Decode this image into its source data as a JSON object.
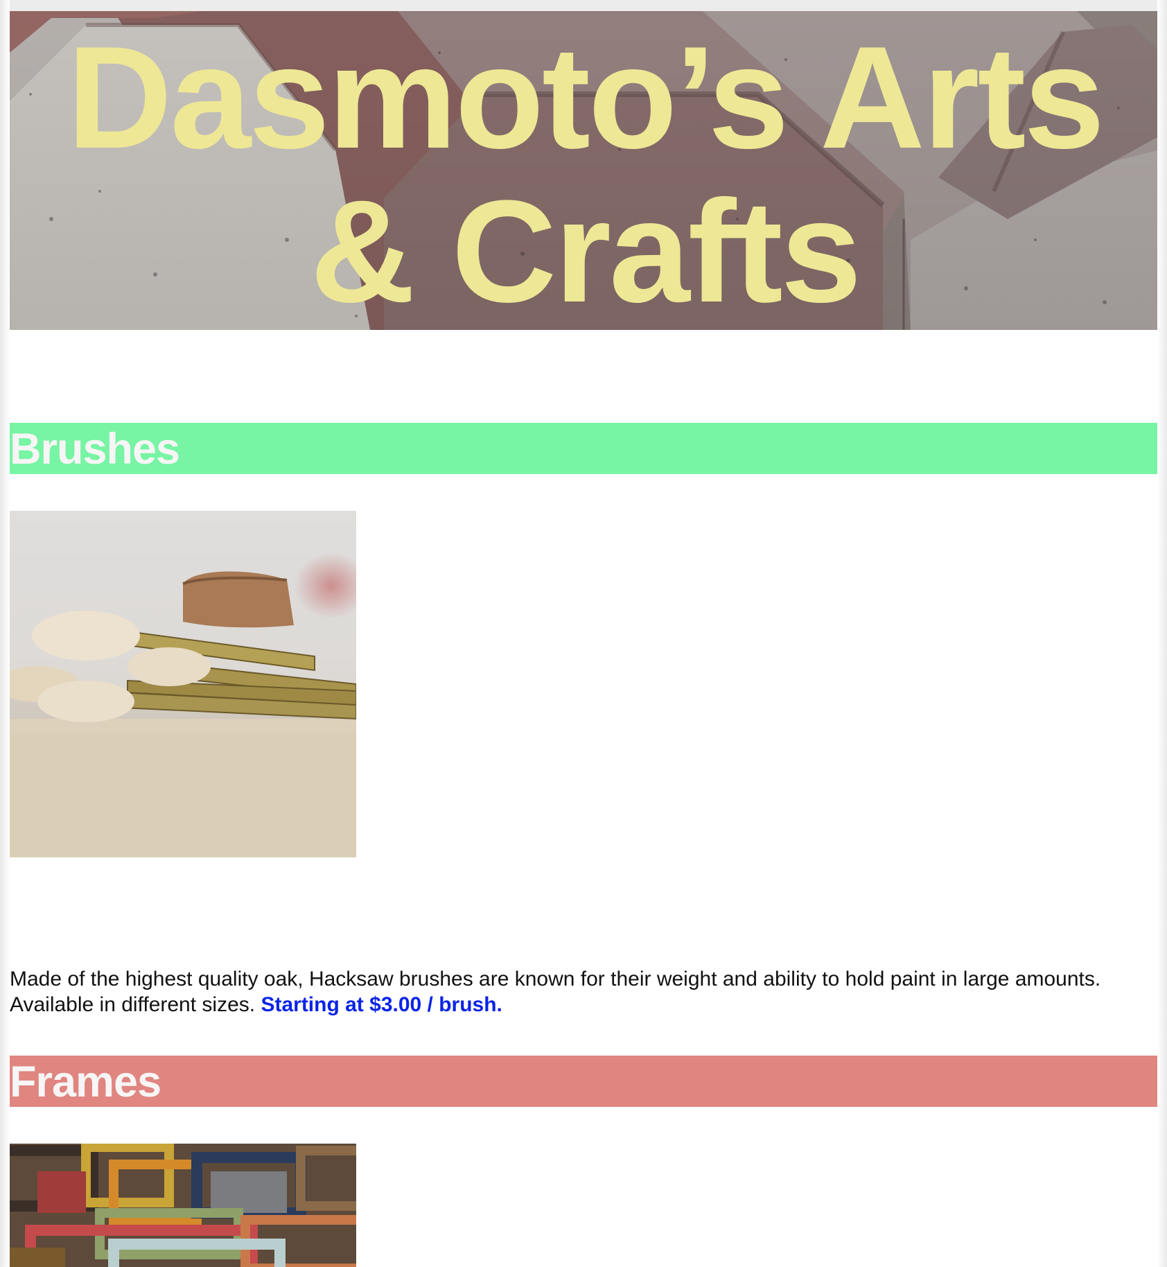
{
  "header": {
    "title": "Dasmoto’s Arts & Crafts"
  },
  "sections": [
    {
      "heading": "Brushes",
      "heading_color": "#77f4a4",
      "image": "paint-brushes-photo",
      "description": "Made of the highest quality oak, Hacksaw brushes are known for their weight and ability to hold paint in large amounts. Available in different sizes.",
      "price": "Starting at $3.00 / brush."
    },
    {
      "heading": "Frames",
      "heading_color": "#e08580",
      "image": "picture-frames-photo"
    }
  ],
  "colors": {
    "title_text": "#eee796",
    "heading_text": "#f7f5f5",
    "price_text": "#0a24e6"
  }
}
